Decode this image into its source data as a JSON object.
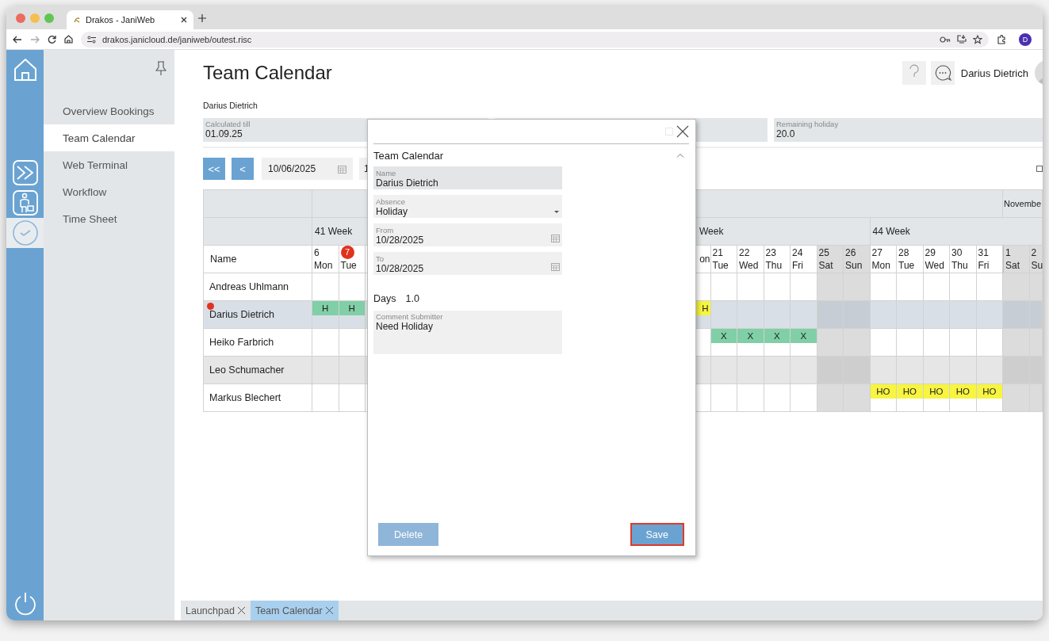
{
  "browser": {
    "tab_title": "Drakos - JaniWeb",
    "url": "drakos.janicloud.de/janiweb/outest.risc",
    "profile_initial": "D"
  },
  "sidebar": {
    "items": [
      {
        "label": "Overview Bookings",
        "selected": false
      },
      {
        "label": "Team Calendar",
        "selected": true
      },
      {
        "label": "Web Terminal",
        "selected": false
      },
      {
        "label": "Workflow",
        "selected": false
      },
      {
        "label": "Time Sheet",
        "selected": false
      }
    ]
  },
  "header": {
    "title": "Team Calendar",
    "user_name": "Darius Dietrich"
  },
  "employee": "Darius Dietrich",
  "info_fields": [
    {
      "label": "Calculated till",
      "value": "01.09.25"
    },
    {
      "kind": "covered"
    },
    {
      "label": "Remaining holiday",
      "value": "20.0"
    }
  ],
  "toolbar": {
    "buttons": [
      {
        "label": "<<"
      },
      {
        "label": "<"
      }
    ],
    "date": "10/06/2025",
    "date_2": "1"
  },
  "calendar": {
    "name_header": "Name",
    "months": [
      {
        "kind": "covered"
      },
      {
        "label": "Novembe"
      }
    ],
    "weeks": [
      {
        "label": "41 Week",
        "days": [
          {
            "day": "6",
            "weekday": "Mon",
            "weekend": false,
            "today": false,
            "new_month": false
          },
          {
            "day": "7",
            "weekday": "Tue",
            "weekend": false,
            "today": true,
            "new_month": false
          },
          {
            "kind": "covered"
          },
          {
            "kind": "covered"
          },
          {
            "kind": "covered"
          },
          {
            "kind": "covered"
          },
          {
            "kind": "covered"
          }
        ]
      },
      {
        "kind": "covered",
        "days": [
          {
            "kind": "covered"
          },
          {
            "kind": "covered"
          },
          {
            "kind": "covered"
          },
          {
            "kind": "covered"
          },
          {
            "kind": "covered"
          },
          {
            "kind": "covered"
          },
          {
            "kind": "covered"
          }
        ]
      },
      {
        "label": "Week",
        "kind": "partial",
        "days": [
          {
            "kind": "partial",
            "weekday": "on",
            "weekend": false
          },
          {
            "day": "21",
            "weekday": "Tue",
            "weekend": false,
            "today": false,
            "new_month": false
          },
          {
            "day": "22",
            "weekday": "Wed",
            "weekend": false,
            "today": false,
            "new_month": false
          },
          {
            "day": "23",
            "weekday": "Thu",
            "weekend": false,
            "today": false,
            "new_month": false
          },
          {
            "day": "24",
            "weekday": "Fri",
            "weekend": false,
            "today": false,
            "new_month": false
          },
          {
            "day": "25",
            "weekday": "Sat",
            "weekend": true,
            "today": false,
            "new_month": false
          },
          {
            "day": "26",
            "weekday": "Sun",
            "weekend": true,
            "today": false,
            "new_month": false
          }
        ]
      },
      {
        "label": "44 Week",
        "days": [
          {
            "day": "27",
            "weekday": "Mon",
            "weekend": false,
            "today": false,
            "new_month": false
          },
          {
            "day": "28",
            "weekday": "Tue",
            "weekend": false,
            "today": false,
            "new_month": false
          },
          {
            "day": "29",
            "weekday": "Wed",
            "weekend": false,
            "today": false,
            "new_month": false
          },
          {
            "day": "30",
            "weekday": "Thu",
            "weekend": false,
            "today": false,
            "new_month": false
          },
          {
            "day": "31",
            "weekday": "Fri",
            "weekend": false,
            "today": false,
            "new_month": false
          },
          {
            "day": "1",
            "weekday": "Sat",
            "weekend": true,
            "today": false,
            "new_month": true
          },
          {
            "day": "2",
            "weekday": "Su",
            "weekend": true,
            "today": false,
            "new_month": false
          }
        ]
      }
    ],
    "rows": [
      {
        "name": "Andreas Uhlmann",
        "selected": false,
        "marker": false,
        "cells": [
          null,
          null,
          null,
          null,
          null,
          null,
          null,
          null,
          null,
          null,
          null,
          null,
          null,
          null,
          null,
          null,
          null,
          null,
          null,
          null,
          null,
          null,
          null,
          null,
          null,
          null,
          null,
          null
        ]
      },
      {
        "name": "Darius Dietrich",
        "selected": true,
        "marker": true,
        "cells": [
          {
            "label": "H",
            "color": "#80cfa7"
          },
          {
            "label": "H",
            "color": "#80cfa7"
          },
          null,
          null,
          null,
          null,
          null,
          null,
          null,
          null,
          null,
          null,
          null,
          null,
          {
            "label": "H",
            "color": "#f7f53f"
          },
          null,
          null,
          null,
          null,
          null,
          null,
          null,
          null,
          null,
          null,
          null,
          null,
          null
        ]
      },
      {
        "name": "Heiko Farbrich",
        "selected": false,
        "marker": false,
        "cells": [
          null,
          null,
          null,
          null,
          null,
          null,
          null,
          null,
          null,
          null,
          null,
          null,
          null,
          null,
          null,
          {
            "label": "X",
            "color": "#80cfa7"
          },
          {
            "label": "X",
            "color": "#80cfa7"
          },
          {
            "label": "X",
            "color": "#80cfa7"
          },
          {
            "label": "X",
            "color": "#80cfa7"
          },
          null,
          null,
          null,
          null,
          null,
          null,
          null,
          null,
          null
        ]
      },
      {
        "name": "Leo Schumacher",
        "selected": false,
        "marker": false,
        "cells": [
          null,
          null,
          null,
          null,
          null,
          null,
          null,
          null,
          null,
          null,
          null,
          null,
          null,
          null,
          null,
          null,
          null,
          null,
          null,
          null,
          null,
          null,
          null,
          null,
          null,
          null,
          null,
          null
        ]
      },
      {
        "name": "Markus Blechert",
        "selected": false,
        "marker": false,
        "cells": [
          null,
          null,
          null,
          null,
          null,
          null,
          null,
          null,
          null,
          null,
          null,
          null,
          null,
          null,
          null,
          null,
          null,
          null,
          null,
          null,
          null,
          {
            "label": "HO",
            "color": "#f7f53f"
          },
          {
            "label": "HO",
            "color": "#f7f53f"
          },
          {
            "label": "HO",
            "color": "#f7f53f"
          },
          {
            "label": "HO",
            "color": "#f7f53f"
          },
          {
            "label": "HO",
            "color": "#f7f53f"
          },
          null,
          null
        ]
      }
    ]
  },
  "dialog": {
    "section_title": "Team Calendar",
    "expanded": true,
    "fields": [
      {
        "kind": "text",
        "label": "Name",
        "value": "Darius Dietrich",
        "readonly": true
      },
      {
        "kind": "select",
        "label": "Absence",
        "value": "Holiday",
        "readonly": false
      },
      {
        "kind": "date",
        "label": "From",
        "value": "10/28/2025",
        "readonly": false
      },
      {
        "kind": "date",
        "label": "To",
        "value": "10/28/2025",
        "readonly": false
      }
    ],
    "days_label": "Days",
    "days_value": "1.0",
    "comment": {
      "label": "Comment Submitter",
      "value": "Need Holiday"
    },
    "buttons": [
      {
        "label": "Delete",
        "disabled": true,
        "focused": false
      },
      {
        "label": "Save",
        "disabled": false,
        "focused": true
      }
    ]
  },
  "bottom_tabs": [
    {
      "label": "Launchpad",
      "selected": false
    },
    {
      "label": "Team Calendar",
      "selected": true
    }
  ]
}
